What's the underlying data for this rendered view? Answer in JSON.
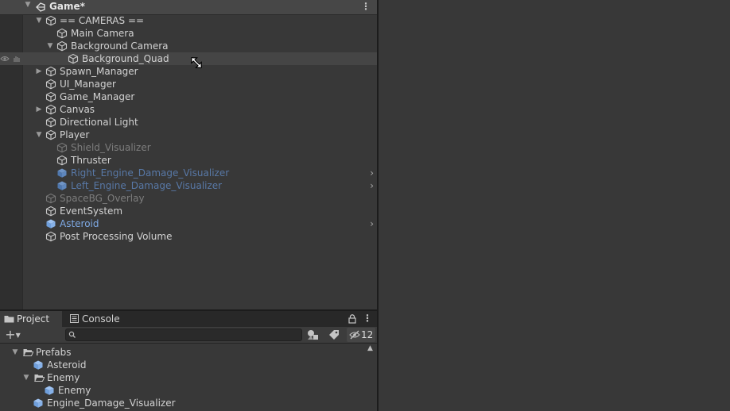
{
  "hierarchy": {
    "scene_name": "Game*",
    "items": [
      {
        "label": "== CAMERAS ==",
        "style": "normal",
        "expand": "down"
      },
      {
        "label": "Main Camera",
        "style": "normal",
        "expand": "none"
      },
      {
        "label": "Background Camera",
        "style": "normal",
        "expand": "down"
      },
      {
        "label": "Background_Quad",
        "style": "normal",
        "expand": "none"
      },
      {
        "label": "Spawn_Manager",
        "style": "normal",
        "expand": "right"
      },
      {
        "label": "UI_Manager",
        "style": "normal",
        "expand": "none"
      },
      {
        "label": "Game_Manager",
        "style": "normal",
        "expand": "none"
      },
      {
        "label": "Canvas",
        "style": "normal",
        "expand": "right"
      },
      {
        "label": "Directional Light",
        "style": "normal",
        "expand": "none"
      },
      {
        "label": "Player",
        "style": "normal",
        "expand": "down"
      },
      {
        "label": "Shield_Visualizer",
        "style": "inactive",
        "expand": "none"
      },
      {
        "label": "Thruster",
        "style": "normal",
        "expand": "none"
      },
      {
        "label": "Right_Engine_Damage_Visualizer",
        "style": "prefab-inactive",
        "expand": "none"
      },
      {
        "label": "Left_Engine_Damage_Visualizer",
        "style": "prefab-inactive",
        "expand": "none"
      },
      {
        "label": "SpaceBG_Overlay",
        "style": "inactive",
        "expand": "none"
      },
      {
        "label": "EventSystem",
        "style": "normal",
        "expand": "none"
      },
      {
        "label": "Asteroid",
        "style": "prefab",
        "expand": "none"
      },
      {
        "label": "Post Processing Volume",
        "style": "normal",
        "expand": "none"
      }
    ]
  },
  "project": {
    "tabs": [
      {
        "label": "Project",
        "icon": "folder-icon"
      },
      {
        "label": "Console",
        "icon": "console-icon"
      }
    ],
    "search_placeholder": "",
    "hidden_count": "12",
    "tree": [
      {
        "label": "Prefabs",
        "type": "folder-open"
      },
      {
        "label": "Asteroid",
        "type": "prefab"
      },
      {
        "label": "Enemy",
        "type": "folder-open"
      },
      {
        "label": "Enemy",
        "type": "prefab"
      },
      {
        "label": "Engine_Damage_Visualizer",
        "type": "prefab"
      }
    ]
  },
  "colors": {
    "panel_bg": "#383838",
    "prefab_blue": "#7ea9e4",
    "inactive_text": "#7d7d7d",
    "highlight_row": "#454545"
  }
}
